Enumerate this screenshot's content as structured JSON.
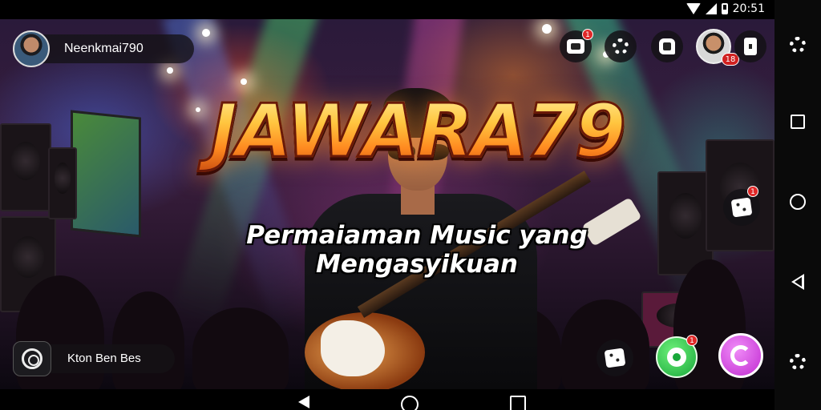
{
  "status_bar": {
    "time": "20:51"
  },
  "profile": {
    "username": "Neenkmai790"
  },
  "logo": {
    "title": "JAWARA79"
  },
  "hero": {
    "subtitle_line1": "Permaiaman Music yang",
    "subtitle_line2": "Mengasyikuan"
  },
  "bottom_left": {
    "label": "Kton Ben Bes"
  },
  "top_icons": {
    "chip_badge": "1",
    "level_badge": "18"
  },
  "side_buttons": {
    "dice_badge": "1",
    "green_badge": "1"
  },
  "icons": [
    "dice-icon",
    "gear-icon",
    "cloud-icon",
    "card-icon",
    "avatar",
    "square-icon",
    "circle-icon",
    "back-icon"
  ],
  "colors": {
    "logo_gold": "#ffc640",
    "logo_outline": "#6a1a08",
    "green_button": "#18a83a",
    "pink_button": "#c02ad0",
    "badge_red": "#e02828"
  }
}
